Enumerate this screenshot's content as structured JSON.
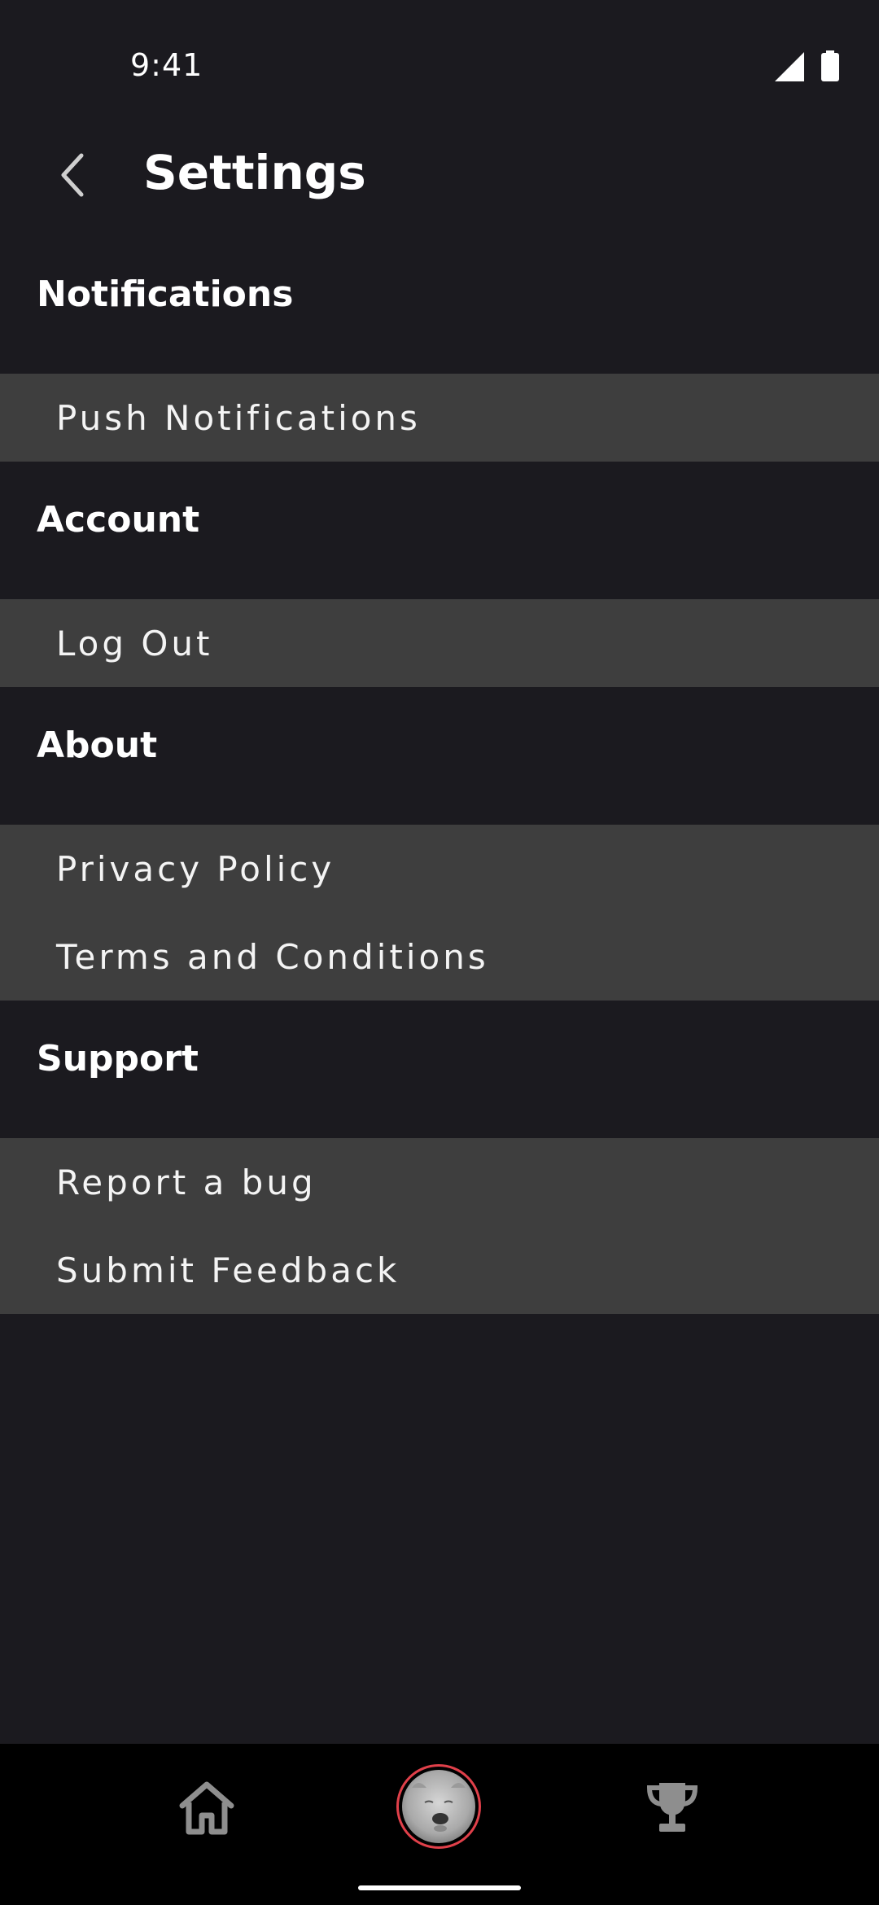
{
  "status_bar": {
    "time": "9:41"
  },
  "header": {
    "title": "Settings"
  },
  "sections": [
    {
      "title": "Notifications",
      "items": [
        "Push Notifications"
      ]
    },
    {
      "title": "Account",
      "items": [
        "Log Out"
      ]
    },
    {
      "title": "About",
      "items": [
        "Privacy Policy",
        "Terms and Conditions"
      ]
    },
    {
      "title": "Support",
      "items": [
        "Report a bug",
        "Submit Feedback"
      ]
    }
  ],
  "bottom_nav": {
    "icons": [
      "home-icon",
      "profile-avatar",
      "trophy-icon"
    ]
  },
  "colors": {
    "background": "#1b1a1f",
    "group_background": "#3e3e3e",
    "nav_background": "#000000",
    "avatar_ring": "#e0404a"
  }
}
